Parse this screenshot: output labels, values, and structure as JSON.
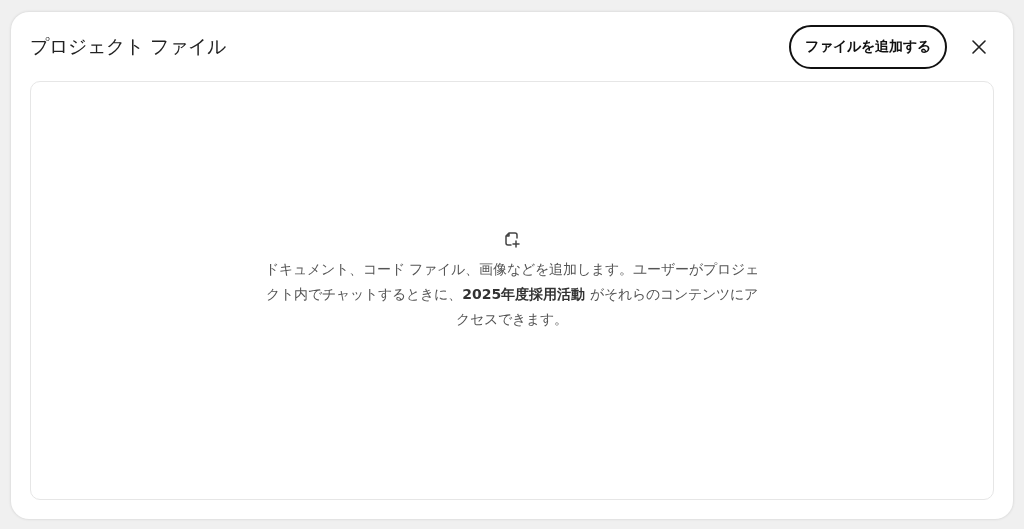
{
  "dialog": {
    "title": "プロジェクト ファイル",
    "add_button": "ファイルを追加する"
  },
  "empty_state": {
    "message": "ドキュメント、コード ファイル、画像などを追加します。ユーザーがプロジェクト内でチャットするときに、**2025年度採用活動** がそれらのコンテンツにアクセスできます。"
  }
}
